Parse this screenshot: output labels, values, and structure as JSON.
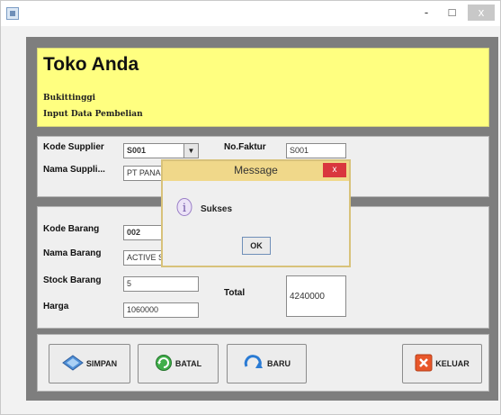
{
  "window": {
    "title": "",
    "controls": [
      "-",
      "□",
      "x"
    ]
  },
  "header": {
    "title": "Toko Anda",
    "city": "Bukittinggi",
    "subtitle": "Input Data Pembelian"
  },
  "supplier": {
    "kode_label": "Kode Supplier",
    "kode_value": "S001",
    "nama_label": "Nama Suppli...",
    "nama_value": "PT PANAS",
    "faktur_label": "No.Faktur",
    "faktur_value": "S001"
  },
  "barang": {
    "kode_label": "Kode Barang",
    "kode_value": "002",
    "nama_label": "Nama Barang",
    "nama_value": "ACTIVE S",
    "stock_label": "Stock Barang",
    "stock_value": "5",
    "harga_label": "Harga",
    "harga_value": "1060000",
    "total_label": "Total",
    "total_value": "4240000"
  },
  "buttons": {
    "simpan": "SIMPAN",
    "batal": "BATAL",
    "baru": "BARU",
    "keluar": "KELUAR"
  },
  "dialog": {
    "title": "Message",
    "close": "x",
    "message": "Sukses",
    "ok": "OK"
  },
  "colors": {
    "header_bg": "#ffff80",
    "dialog_title_bg": "#f0d88a",
    "close_red": "#d9363e"
  }
}
